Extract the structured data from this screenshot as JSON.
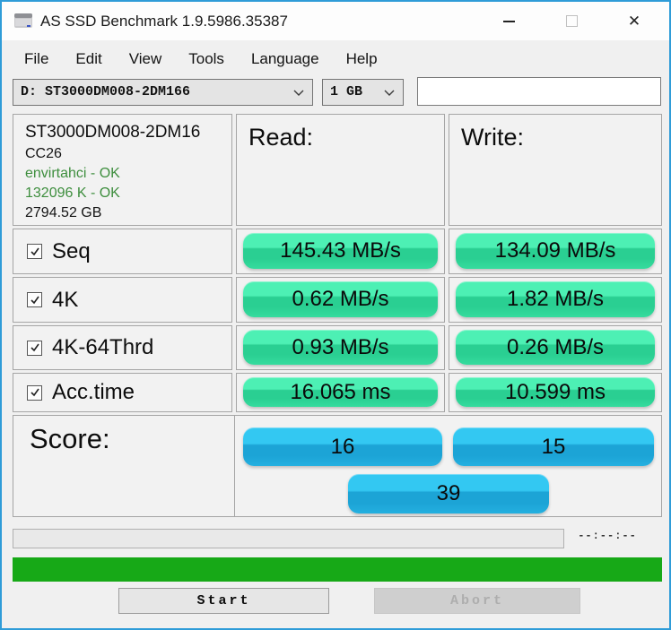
{
  "window": {
    "title": "AS SSD Benchmark 1.9.5986.35387",
    "icons": {
      "app": "drive-icon",
      "minimize": "minimize-icon",
      "maximize": "maximize-icon",
      "close": "close-icon",
      "dropdown": "chevron-down-icon",
      "checkbox_check": "check-icon"
    },
    "close_glyph": "✕"
  },
  "menu": {
    "items": [
      "File",
      "Edit",
      "View",
      "Tools",
      "Language",
      "Help"
    ]
  },
  "toolbar": {
    "drive_select": "D: ST3000DM008-2DM166",
    "size_select": "1 GB",
    "text_field_value": ""
  },
  "info": {
    "model": "ST3000DM008-2DM16",
    "firmware": "CC26",
    "driver_status": "envirtahci - OK",
    "alignment_status": "132096 K - OK",
    "capacity": "2794.52 GB"
  },
  "columns": {
    "read": "Read:",
    "write": "Write:"
  },
  "tests": [
    {
      "label": "Seq",
      "checked": true,
      "read": "145.43 MB/s",
      "write": "134.09 MB/s"
    },
    {
      "label": "4K",
      "checked": true,
      "read": "0.62 MB/s",
      "write": "1.82 MB/s"
    },
    {
      "label": "4K-64Thrd",
      "checked": true,
      "read": "0.93 MB/s",
      "write": "0.26 MB/s"
    },
    {
      "label": "Acc.time",
      "checked": true,
      "read": "16.065 ms",
      "write": "10.599 ms"
    }
  ],
  "score": {
    "label": "Score:",
    "read": "16",
    "write": "15",
    "total": "39"
  },
  "progress": {
    "time": "--:--:--"
  },
  "buttons": {
    "start": "Start",
    "abort": "Abort"
  },
  "colors": {
    "window_border": "#2f9cd8",
    "titlebar_bg": "#fdfdfd",
    "window_bg": "#f0f0f0",
    "panel_border": "#a5a5a5",
    "green_text": "#3e8e3e",
    "pill_green_top": "#4df0b4",
    "pill_green_mid": "#2acf92",
    "pill_green_bottom": "#35dc9e",
    "pill_blue_top": "#33c8f2",
    "pill_blue_mid": "#1ca4d6",
    "pill_blue_bottom": "#24b0e0",
    "progress_green": "#17a917"
  }
}
